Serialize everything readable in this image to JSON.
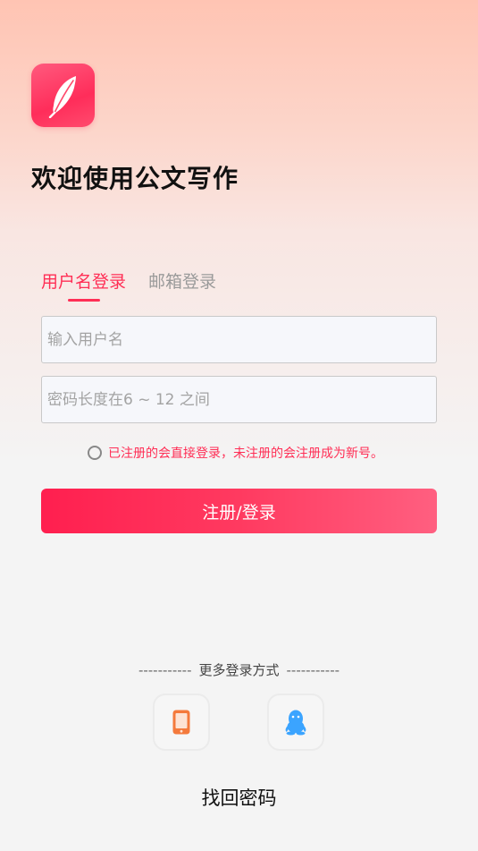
{
  "welcome_title": "欢迎使用公文写作",
  "tabs": [
    {
      "label": "用户名登录",
      "active": true
    },
    {
      "label": "邮箱登录",
      "active": false
    }
  ],
  "username_field": {
    "value": "",
    "placeholder": "输入用户名"
  },
  "password_field": {
    "value": "",
    "placeholder": "密码长度在6 ~ 12 之间"
  },
  "agreement": {
    "text": "已注册的会直接登录，未注册的会注册成为新号。",
    "checked": false
  },
  "submit_label": "注册/登录",
  "more_login": {
    "dashes": "-----------",
    "label": "更多登录方式"
  },
  "social_logins": [
    {
      "icon": "phone-icon",
      "color": "#f47a3c"
    },
    {
      "icon": "qq-penguin-icon",
      "color": "#3ba4ff"
    }
  ],
  "find_password_label": "找回密码",
  "colors": {
    "accent": "#ff2e55",
    "button_start": "#ff1f4f",
    "button_end": "#ff5f80",
    "inactive_tab": "#9a9a9a"
  },
  "icons": {
    "logo": "feather-logo-icon"
  }
}
